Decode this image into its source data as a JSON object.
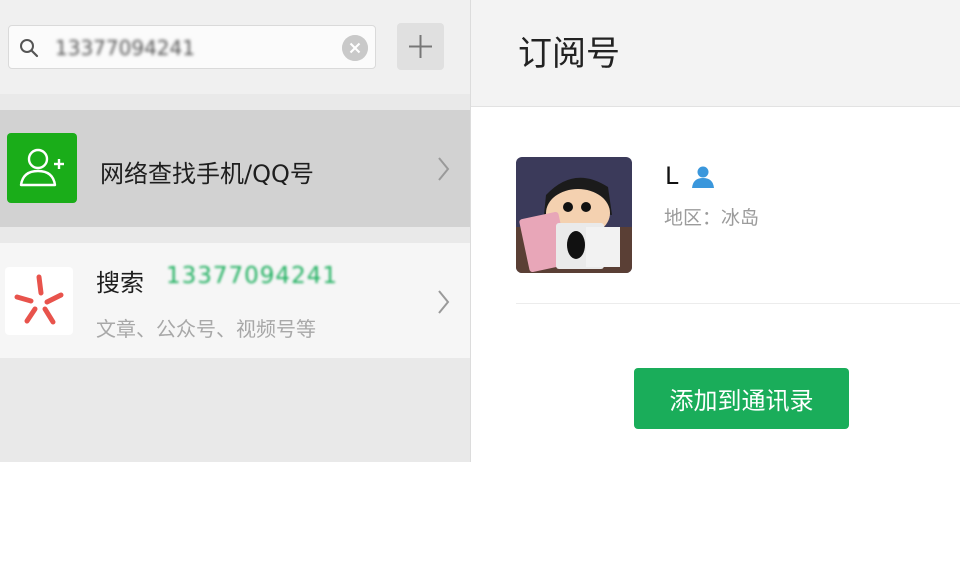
{
  "search": {
    "value": "13377094241",
    "add_label": "+"
  },
  "items": {
    "network": {
      "title": "网络查找手机/QQ号"
    },
    "search": {
      "label": "搜索",
      "query": "13377094241",
      "subtitle": "文章、公众号、视频号等"
    }
  },
  "main": {
    "title": "订阅号",
    "contact": {
      "name": "L",
      "region": "地区：冰岛"
    },
    "add_button_label": "添加到通讯录"
  },
  "colors": {
    "wechat_green": "#1aad19",
    "button_green": "#1aad5a",
    "person_blue": "#3a97dc"
  }
}
